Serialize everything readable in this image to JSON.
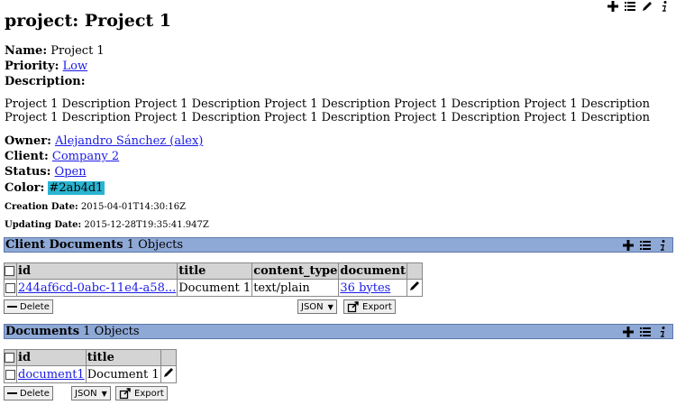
{
  "page": {
    "title": "project: Project 1",
    "fields": {
      "name_label": "Name:",
      "name_value": "Project 1",
      "priority_label": "Priority:",
      "priority_value": "Low",
      "description_label": "Description:",
      "description_text": "Project 1 Description Project 1 Description Project 1 Description Project 1 Description Project 1 Description Project 1 Description Project 1 Description Project 1 Description Project 1 Description Project 1 Description",
      "owner_label": "Owner:",
      "owner_value": "Alejandro Sánchez (alex)",
      "client_label": "Client:",
      "client_value": "Company 2",
      "status_label": "Status:",
      "status_value": "Open",
      "color_label": "Color:",
      "color_value": "#2ab4d1",
      "creation_label": "Creation Date:",
      "creation_value": "2015-04-01T14:30:16Z",
      "updating_label": "Updating Date:",
      "updating_value": "2015-12-28T19:35:41.947Z"
    }
  },
  "colors": {
    "section_bar": "#8fa9d6",
    "header_cell": "#d4d4d4",
    "link": "#1a1ae6",
    "swatch": "#2ab4d1"
  },
  "client_documents": {
    "title": "Client Documents",
    "count": "1 Objects",
    "columns": [
      "id",
      "title",
      "content_type",
      "document"
    ],
    "rows": [
      {
        "id": "244af6cd-0abc-11e4-a58...",
        "title": "Document 1",
        "content_type": "text/plain",
        "document": "36 bytes"
      }
    ],
    "delete_label": "Delete",
    "format_value": "JSON",
    "export_label": "Export"
  },
  "documents": {
    "title": "Documents",
    "count": "1 Objects",
    "columns": [
      "id",
      "title"
    ],
    "rows": [
      {
        "id": "document1",
        "title": "Document 1"
      }
    ],
    "delete_label": "Delete",
    "format_value": "JSON",
    "export_label": "Export"
  },
  "icons": [
    "plus-icon",
    "list-icon",
    "pencil-icon",
    "info-icon"
  ]
}
